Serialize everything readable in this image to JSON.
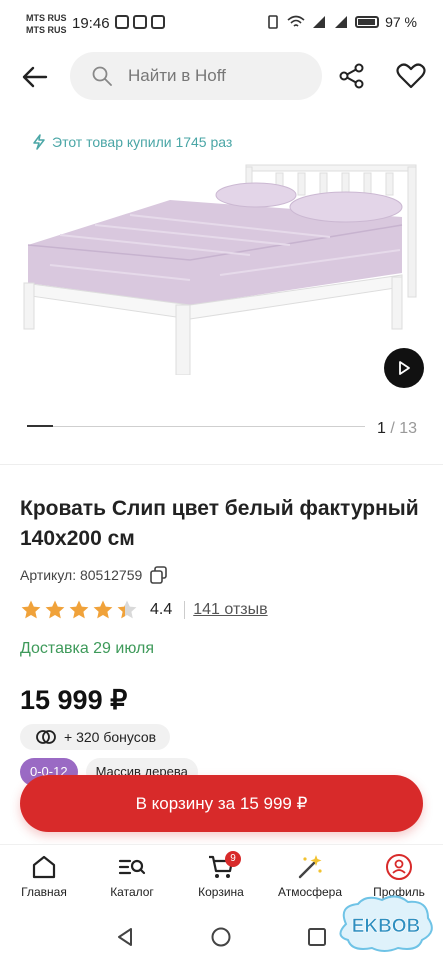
{
  "status_bar": {
    "carrier_1": "MTS RUS",
    "carrier_2": "MTS RUS",
    "time": "19:46",
    "battery": "97 %"
  },
  "header": {
    "search_placeholder": "Найти в Hoff"
  },
  "gallery": {
    "bought_text": "Этот товар купили 1745 раз",
    "current_page": "1",
    "separator": "/",
    "total_pages": "13",
    "progress_fraction": 0.077
  },
  "product": {
    "title": "Кровать Слип цвет белый фактурный 140х200 см",
    "article": "Артикул: 80512759",
    "rating": "4.4",
    "rating_value": 4.4,
    "reviews": "141 отзыв",
    "delivery": "Доставка 29 июля",
    "price": "15 999 ₽",
    "bonus": "+ 320 бонусов",
    "tags": [
      "0-0-12",
      "Массив дерева"
    ]
  },
  "cta": {
    "label": "В корзину за 15 999 ₽"
  },
  "bottom_nav": {
    "items": [
      {
        "label": "Главная",
        "icon": "home-icon"
      },
      {
        "label": "Каталог",
        "icon": "catalog-icon"
      },
      {
        "label": "Корзина",
        "icon": "cart-icon",
        "badge": "9"
      },
      {
        "label": "Атмосфера",
        "icon": "atmosphere-icon"
      },
      {
        "label": "Профиль",
        "icon": "profile-icon"
      }
    ]
  },
  "watermark": {
    "text": "EKBOB"
  },
  "colors": {
    "accent_red": "#d82a2a",
    "delivery_green": "#3e9a5a",
    "bought_teal": "#4aa6a6",
    "star_orange": "#f0a23a",
    "tag_purple": "#9a6ac4"
  }
}
